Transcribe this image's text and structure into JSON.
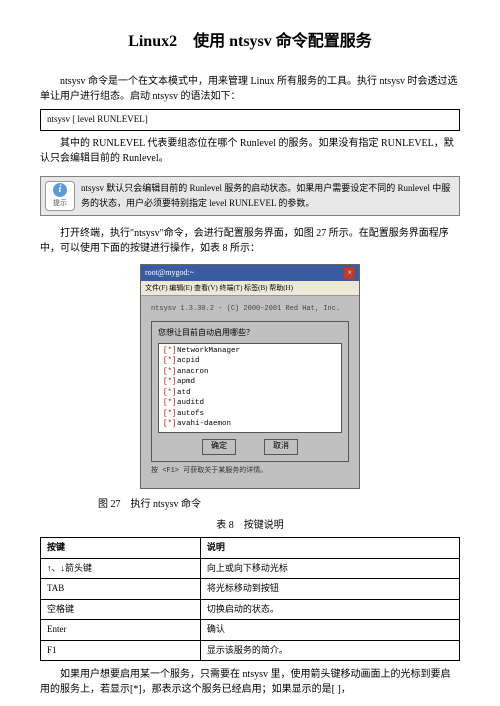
{
  "title": "Linux2　使用 ntsysv 命令配置服务",
  "intro1": "ntsysv 命令是一个在文本模式中，用来管理 Linux 所有服务的工具。执行 ntsysv 时会透过选单让用户进行组态。启动 ntsysv 的语法如下：",
  "syntax": "ntsysv [ level RUNLEVEL]",
  "intro2": "其中的 RUNLEVEL 代表要组态位在哪个 Runlevel 的服务。如果没有指定 RUNLEVEL，默认只会编辑目前的 Runlevel。",
  "tip_label": "提示",
  "tip_text": "ntsysv 默认只会编辑目前的 Runlevel 服务的启动状态。如果用户需要设定不同的 Runlevel 中服务的状态，用户必须要特别指定 level RUNLEVEL 的参数。",
  "para3": "打开终端，执行\"ntsysv\"命令，会进行配置服务界面，如图 27 所示。在配置服务界面程序中，可以使用下面的按键进行操作，如表 8 所示：",
  "window": {
    "titlebar": "root@mygod:~",
    "close": "×",
    "menu": "文件(F) 编辑(E) 查看(V) 终端(T) 标签(B) 帮助(H)",
    "version": "ntsysv 1.3.30.2 - (C) 2000-2001 Red Hat, Inc.",
    "heading": "您想让目前自动启用哪些？",
    "services": [
      {
        "check": "[*]",
        "name": "NetworkManager"
      },
      {
        "check": "[*]",
        "name": "acpid"
      },
      {
        "check": "[*]",
        "name": "anacron"
      },
      {
        "check": "[*]",
        "name": "apmd"
      },
      {
        "check": "[*]",
        "name": "atd"
      },
      {
        "check": "[*]",
        "name": "auditd"
      },
      {
        "check": "[*]",
        "name": "autofs"
      },
      {
        "check": "[*]",
        "name": "avahi-daemon"
      }
    ],
    "ok_btn": "确定",
    "cancel_btn": "取消",
    "hint": "按 <F1> 可获取关于某服务的详情。"
  },
  "figure_caption": "图 27　执行 ntsysv 命令",
  "table_caption": "表 8　按键说明",
  "table": {
    "h1": "按键",
    "h2": "说明",
    "rows": [
      {
        "k": "↑、↓箭头键",
        "d": "向上或向下移动光标"
      },
      {
        "k": "TAB",
        "d": "将光标移动到按钮"
      },
      {
        "k": "空格键",
        "d": "切换启动的状态。"
      },
      {
        "k": "Enter",
        "d": "确认"
      },
      {
        "k": "F1",
        "d": "显示该服务的简介。"
      }
    ]
  },
  "para4": "如果用户想要启用某一个服务，只需要在 ntsysv 里，使用箭头键移动画面上的光标到要启用的服务上，若显示[*]，那表示这个服务已经启用；如果显示的是[  ]，"
}
